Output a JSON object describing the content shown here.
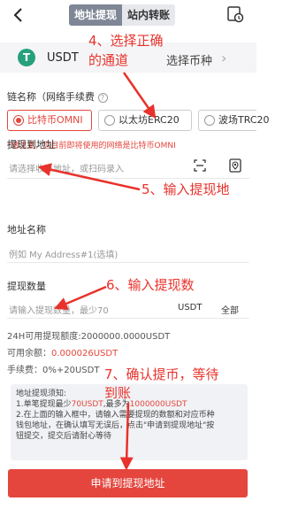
{
  "header": {
    "tabs": [
      {
        "label": "地址提现",
        "active": true
      },
      {
        "label": "站内转账",
        "active": false
      }
    ]
  },
  "coin": {
    "icon_text": "T",
    "name": "USDT",
    "select_label": "选择币种",
    "chevron": "›"
  },
  "chain": {
    "title": "链名称（网络手续费",
    "options": [
      {
        "label": "比特币OMNI",
        "selected": true
      },
      {
        "label": "以太坊ERC20",
        "selected": false
      },
      {
        "label": "波场TRC20",
        "selected": false
      }
    ],
    "warning": "*请注意，您目前即将使用的网络是比特币OMNI"
  },
  "address": {
    "title": "提现到地址",
    "placeholder": "请选择收币地址，或扫码录入"
  },
  "addr_name": {
    "title": "地址名称",
    "placeholder": "例如 My Address#1(选填)"
  },
  "amount": {
    "title": "提现数量",
    "placeholder": "请输入提现数量，最少70",
    "unit": "USDT",
    "all_label": "全部"
  },
  "limits": {
    "daily": "24H可用提现额度:2000000.0000USDT",
    "balance_label": "可用余额：",
    "balance_value": "0.000026USDT",
    "fee": "手续费：0%+20USDT"
  },
  "notice": {
    "title": "地址提现须知:",
    "line1_a": "1.单笔提现最少",
    "line1_min": "70USDT",
    "line1_b": ",最多为",
    "line1_max": "1000000USDT",
    "line2": "2.在上面的输入框中，请输入需要提现的数额和对应币种",
    "line3": "钱包地址，在确认填写无误后，点击\"申请到提现地址\"按",
    "line4": "钮提交，提交后请耐心等待"
  },
  "submit_label": "申请到提现地址",
  "annotations": {
    "a4_line1": "4、选择正确",
    "a4_line2": "的通道",
    "a5": "5、输入提现地",
    "a6": "6、输入提现数",
    "a7_line1": "7、确认提币，等待",
    "a7_line2": "到账"
  },
  "colors": {
    "accent": "#e4463e",
    "annotation": "#e8322b",
    "tether": "#26a17b"
  }
}
